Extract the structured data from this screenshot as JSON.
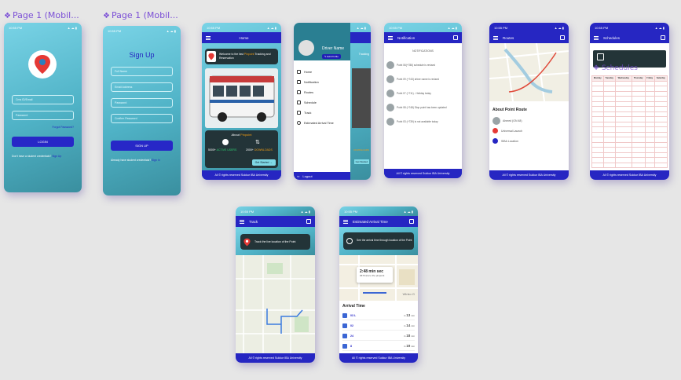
{
  "labels": {
    "frame1": "Page 1 (Mobil...",
    "frame2": "Page 1 (Mobil..."
  },
  "status": {
    "time": "10:55 PM",
    "net": "5G",
    "right": "▲ ☁ ▮"
  },
  "login": {
    "email": "Cms ID/Email",
    "password": "Password",
    "forgot": "Forgot Password?",
    "login_btn": "LOGIN",
    "no_account": "Don't have a student credentials?",
    "signup_link": "Sign Up"
  },
  "signup": {
    "title": "Sign Up",
    "full_name": "Full Name",
    "email": "Email Address",
    "password": "Password",
    "confirm": "Confirm Password",
    "btn": "SIGN UP",
    "have_account": "Already have student credentials?",
    "signin_link": "Sign In"
  },
  "home": {
    "title": "Home",
    "welcome_pre": "Welcome to the fast ",
    "welcome_brand": "Pinpoint",
    "welcome_post": " Tracking and Reservation",
    "about_pre": "About ",
    "about_brand": "Pinpoint",
    "users_count": "5000+",
    "users_label": "ACTIVE USERS",
    "downloads_count": "2000+",
    "downloads_label": "DOWNLOADS",
    "get_started": "Get Started",
    "footer": "All © rights reserved Sukkur IBA University"
  },
  "drawer": {
    "driver_name": "Driver Name",
    "edit_profile": "Edit Profile",
    "items": [
      "Home",
      "Notification",
      "Routes",
      "Schedule",
      "Track",
      "Estimated Arrival Time"
    ],
    "logout": "Logout",
    "behind_tracking": "Tracking",
    "behind_get": "Get Started",
    "behind_downloads": "DOWNLOADS"
  },
  "notification": {
    "title": "Notification",
    "header": "NOTIFICATIONS",
    "items": [
      "Point 06(+786) schedule is revised",
      "Point 09 (+743) driver name is revised",
      "Point 07 (+711) - Holiday today",
      "Point 08 (+748) Stop point has been updated",
      "Point 03 (+739) is not available today"
    ],
    "footer": "All © rights reserved Sukkur IBA University"
  },
  "routes": {
    "title": "Routes",
    "about": "About Point Route",
    "driver": "Ahmed (GN 48)",
    "start": "Universal Launch",
    "end": "SIBA Location",
    "footer": "All © rights reserved Sukkur IBA University"
  },
  "schedules": {
    "title": "Schedules",
    "heading": "Schedules",
    "columns": [
      "Monday",
      "Tuesday",
      "Wednesday",
      "Thursday",
      "Friday",
      "Saturday"
    ],
    "footer": "All © rights reserved Sukkur IBA University"
  },
  "track": {
    "title": "Track",
    "message": "Track the live location of the Point",
    "footer": "All © rights reserved Sukkur IBA University"
  },
  "eta": {
    "title": "Estimated Arrival Time",
    "message": "See the arrival time through location of the Point",
    "time": "2:48 min sec",
    "subtitle": "0670 (N) to the pinpoint",
    "map_text": "Winko G",
    "section": "Arrival Time",
    "rows": [
      {
        "label": "03 L",
        "prefix": "in",
        "minutes": "13",
        "unit": "min"
      },
      {
        "label": "02",
        "prefix": "in",
        "minutes": "14",
        "unit": "min"
      },
      {
        "label": "24",
        "prefix": "in",
        "minutes": "18",
        "unit": "min"
      },
      {
        "label": "8",
        "prefix": "in",
        "minutes": "19",
        "unit": "min"
      }
    ],
    "footer": "All © rights reserved Sukkur IBA University"
  },
  "colors": {
    "accent": "#2626c2",
    "brand_label": "#7b4fd6",
    "gradient_top": "#79d3e6",
    "gradient_bottom": "#3a8f9f"
  }
}
